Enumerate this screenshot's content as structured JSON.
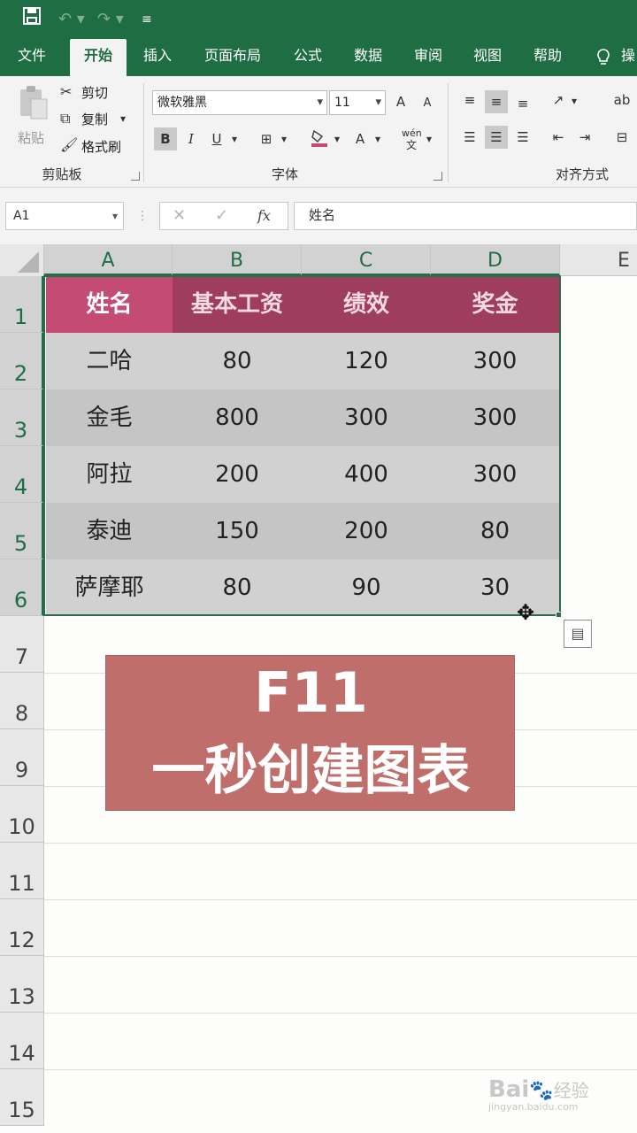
{
  "titlebar": {
    "save_icon": "save-icon",
    "undo_icon": "undo-icon",
    "redo_icon": "redo-icon",
    "customize_icon": "customize-quick-access-icon"
  },
  "tabs": [
    {
      "label": "文件"
    },
    {
      "label": "开始"
    },
    {
      "label": "插入"
    },
    {
      "label": "页面布局"
    },
    {
      "label": "公式"
    },
    {
      "label": "数据"
    },
    {
      "label": "审阅"
    },
    {
      "label": "视图"
    },
    {
      "label": "帮助"
    },
    {
      "label": "操"
    }
  ],
  "ribbon": {
    "paste": "粘贴",
    "cut": "剪切",
    "copy": "复制",
    "format_painter": "格式刷",
    "clipboard_group": "剪贴板",
    "font_name": "微软雅黑",
    "font_size": "11",
    "bold": "B",
    "italic": "I",
    "underline": "U",
    "font_color": "A",
    "font_group": "字体",
    "phonetic": "wén",
    "phonetic_sub": "文",
    "grow_font": "A",
    "shrink_font": "A",
    "align_group": "对齐方式",
    "wrap_text": "ab"
  },
  "formula_bar": {
    "name_box": "A1",
    "fx_label": "fx",
    "formula": "姓名",
    "cancel": "✕",
    "enter": "✓"
  },
  "columns": [
    "A",
    "B",
    "C",
    "D",
    "E"
  ],
  "rows": [
    "1",
    "2",
    "3",
    "4",
    "5",
    "6",
    "7",
    "8",
    "9",
    "10",
    "11",
    "12",
    "13",
    "14",
    "15"
  ],
  "table": {
    "headers": [
      "姓名",
      "基本工资",
      "绩效",
      "奖金"
    ],
    "rows": [
      [
        "二哈",
        "80",
        "120",
        "300"
      ],
      [
        "金毛",
        "800",
        "300",
        "300"
      ],
      [
        "阿拉",
        "200",
        "400",
        "300"
      ],
      [
        "泰迪",
        "150",
        "200",
        "80"
      ],
      [
        "萨摩耶",
        "80",
        "90",
        "30"
      ]
    ]
  },
  "banner": {
    "line1": "F11",
    "line2": "一秒创建图表"
  },
  "watermark": {
    "brand": "Bai",
    "brand2": "经验",
    "url": "jingyan.baidu.com"
  },
  "colors": {
    "excel_green": "#1f6e43",
    "header_accent": "#c44b73",
    "header": "#9e3d5e",
    "banner": "#c06e6b"
  }
}
